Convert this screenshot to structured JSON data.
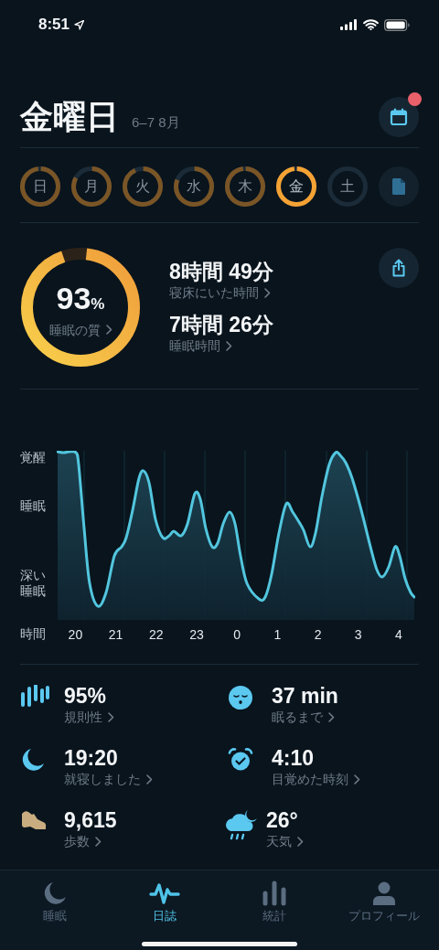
{
  "status_bar": {
    "time": "8:51"
  },
  "header": {
    "title": "金曜日",
    "subtitle": "6–7 8月",
    "calendar_badge": true
  },
  "days": [
    {
      "label": "日",
      "level": 0.97,
      "selected": false
    },
    {
      "label": "月",
      "level": 0.82,
      "selected": false
    },
    {
      "label": "火",
      "level": 0.92,
      "selected": false
    },
    {
      "label": "水",
      "level": 0.8,
      "selected": false
    },
    {
      "label": "木",
      "level": 0.97,
      "selected": false
    },
    {
      "label": "金",
      "level": 0.97,
      "selected": true
    },
    {
      "label": "土",
      "level": 0,
      "selected": false
    }
  ],
  "summary": {
    "quality": {
      "value": "93",
      "unit": "%",
      "label": "睡眠の質",
      "level": 0.93
    },
    "metrics": [
      {
        "value": "8時間 49分",
        "label": "寝床にいた時間"
      },
      {
        "value": "7時間 26分",
        "label": "睡眠時間"
      }
    ]
  },
  "chart": {
    "y_labels": [
      "覚醒",
      "睡眠",
      "深い睡眠"
    ],
    "x_title": "時間",
    "hours": [
      "20",
      "21",
      "22",
      "23",
      "0",
      "1",
      "2",
      "3",
      "4"
    ]
  },
  "stats": [
    {
      "kind": "regularity",
      "value": "95%",
      "label": "規則性"
    },
    {
      "kind": "sleepy",
      "value": "37 min",
      "label": "眠るまで"
    },
    {
      "kind": "bedtime",
      "value": "19:20",
      "label": "就寝しました"
    },
    {
      "kind": "alarm",
      "value": "4:10",
      "label": "目覚めた時刻"
    },
    {
      "kind": "steps",
      "value": "9,615",
      "label": "歩数"
    },
    {
      "kind": "weather",
      "value": "26°",
      "label": "天気"
    }
  ],
  "tabs": [
    {
      "kind": "moon",
      "label": "睡眠",
      "selected": false
    },
    {
      "kind": "wave",
      "label": "日誌",
      "selected": true
    },
    {
      "kind": "bars",
      "label": "統計",
      "selected": false
    },
    {
      "kind": "person",
      "label": "プロフィール",
      "selected": false
    }
  ]
}
